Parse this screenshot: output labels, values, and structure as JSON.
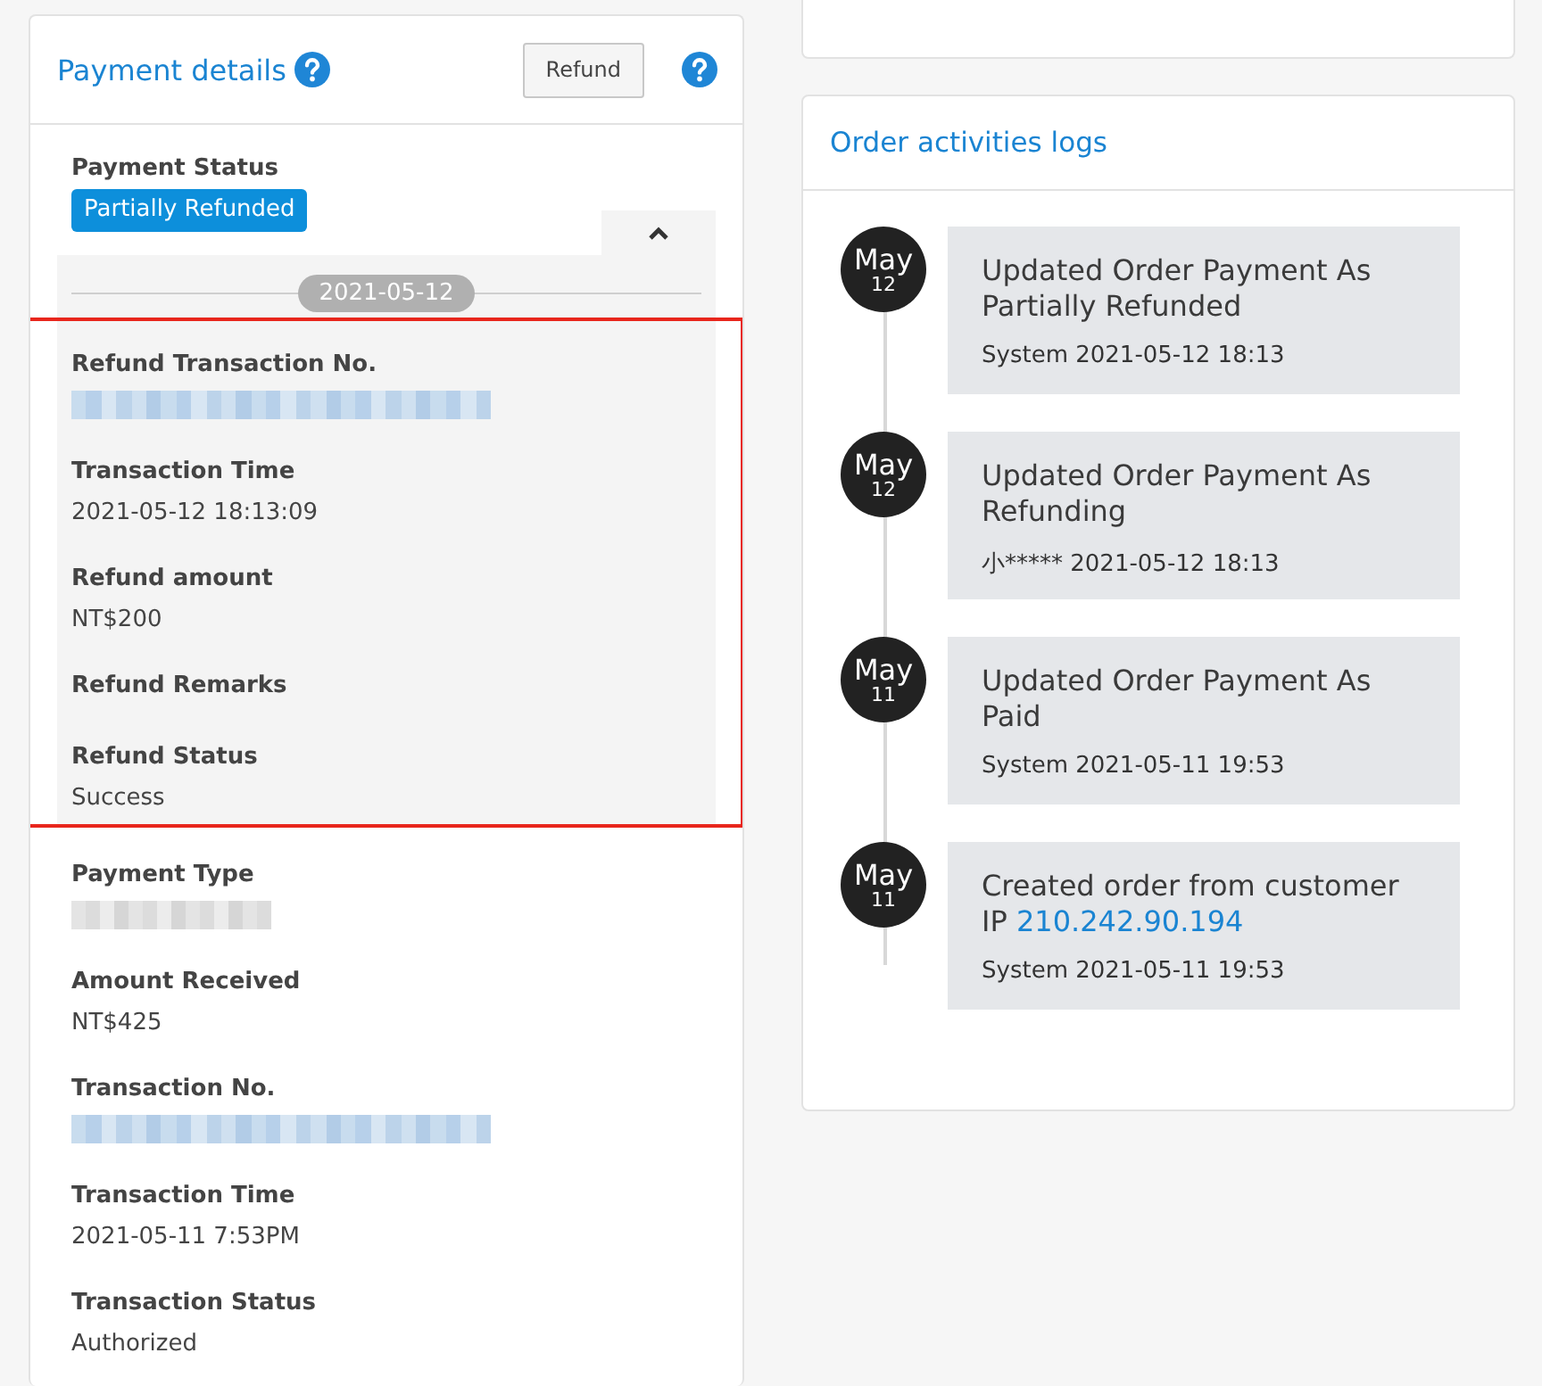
{
  "payment_details": {
    "title": "Payment details",
    "refund_button": "Refund",
    "payment_status": {
      "label": "Payment Status",
      "badge": "Partially Refunded"
    },
    "refund_section": {
      "expanded": true,
      "highlighted": true,
      "date": "2021-05-12",
      "fields": [
        {
          "label": "Refund Transaction No.",
          "redacted": true
        },
        {
          "label": "Transaction Time",
          "value": "2021-05-12 18:13:09"
        },
        {
          "label": "Refund amount",
          "value": "NT$200"
        },
        {
          "label": "Refund Remarks"
        },
        {
          "label": "Refund Status",
          "value": "Success"
        }
      ]
    },
    "fields": [
      {
        "label": "Payment Type",
        "redacted": true
      },
      {
        "label": "Amount Received",
        "value": "NT$425"
      },
      {
        "label": "Transaction No.",
        "redacted": true
      },
      {
        "label": "Transaction Time",
        "value": "2021-05-11 7:53PM"
      },
      {
        "label": "Transaction Status",
        "value": "Authorized"
      }
    ]
  },
  "order_activities": {
    "title": "Order activities logs",
    "entries": [
      {
        "month": "May",
        "day": "12",
        "title": "Updated Order Payment As Partially Refunded",
        "meta": "System 2021-05-12 18:13"
      },
      {
        "month": "May",
        "day": "12",
        "title": "Updated Order Payment As Refunding",
        "meta": "小***** 2021-05-12 18:13"
      },
      {
        "month": "May",
        "day": "11",
        "title": "Updated Order Payment As Paid",
        "meta": "System 2021-05-11 19:53"
      },
      {
        "month": "May",
        "day": "11",
        "title": "Created order from customer IP",
        "link": "210.242.90.194",
        "meta": "System 2021-05-11 19:53"
      }
    ]
  }
}
